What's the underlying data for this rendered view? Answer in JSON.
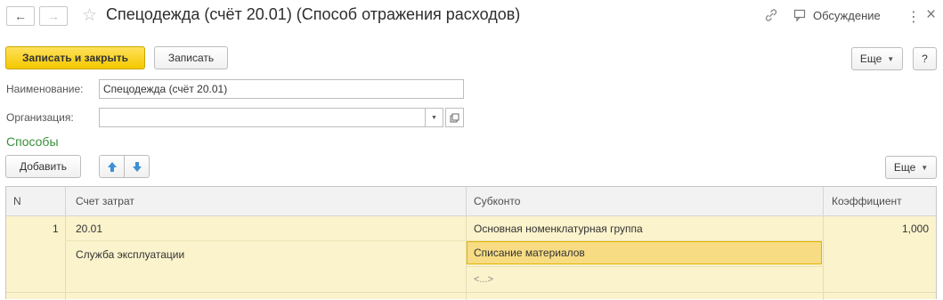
{
  "header": {
    "title": "Спецодежда (счёт 20.01) (Способ отражения расходов)",
    "back_icon": "arrow-left-icon",
    "forward_icon": "arrow-right-icon",
    "star_icon": "star-icon",
    "link_icon": "link-icon",
    "discussion_label": "Обсуждение",
    "more_icon": "more-vertical-icon",
    "close_icon": "close-icon"
  },
  "toolbar": {
    "save_close_label": "Записать и закрыть",
    "save_label": "Записать",
    "more_label": "Еще",
    "help_label": "?"
  },
  "form": {
    "name_label": "Наименование:",
    "name_value": "Спецодежда (счёт 20.01)",
    "org_label": "Организация:",
    "org_value": ""
  },
  "methods": {
    "title": "Способы",
    "add_label": "Добавить",
    "more_label": "Еще",
    "columns": [
      "N",
      "Счет затрат",
      "Субконто",
      "Коэффициент"
    ],
    "rows": [
      {
        "n": "1",
        "account": "20.01",
        "account_sub": "Служба эксплуатации",
        "subconto": [
          "Основная номенклатурная группа",
          "Списание материалов",
          "<...>"
        ],
        "coefficient": "1,000"
      }
    ]
  },
  "colors": {
    "accent_yellow": "#f4c900",
    "group_title": "#3a8f3a",
    "row_bg": "#fbf3cc",
    "selected_cell": "#f7dc84"
  }
}
